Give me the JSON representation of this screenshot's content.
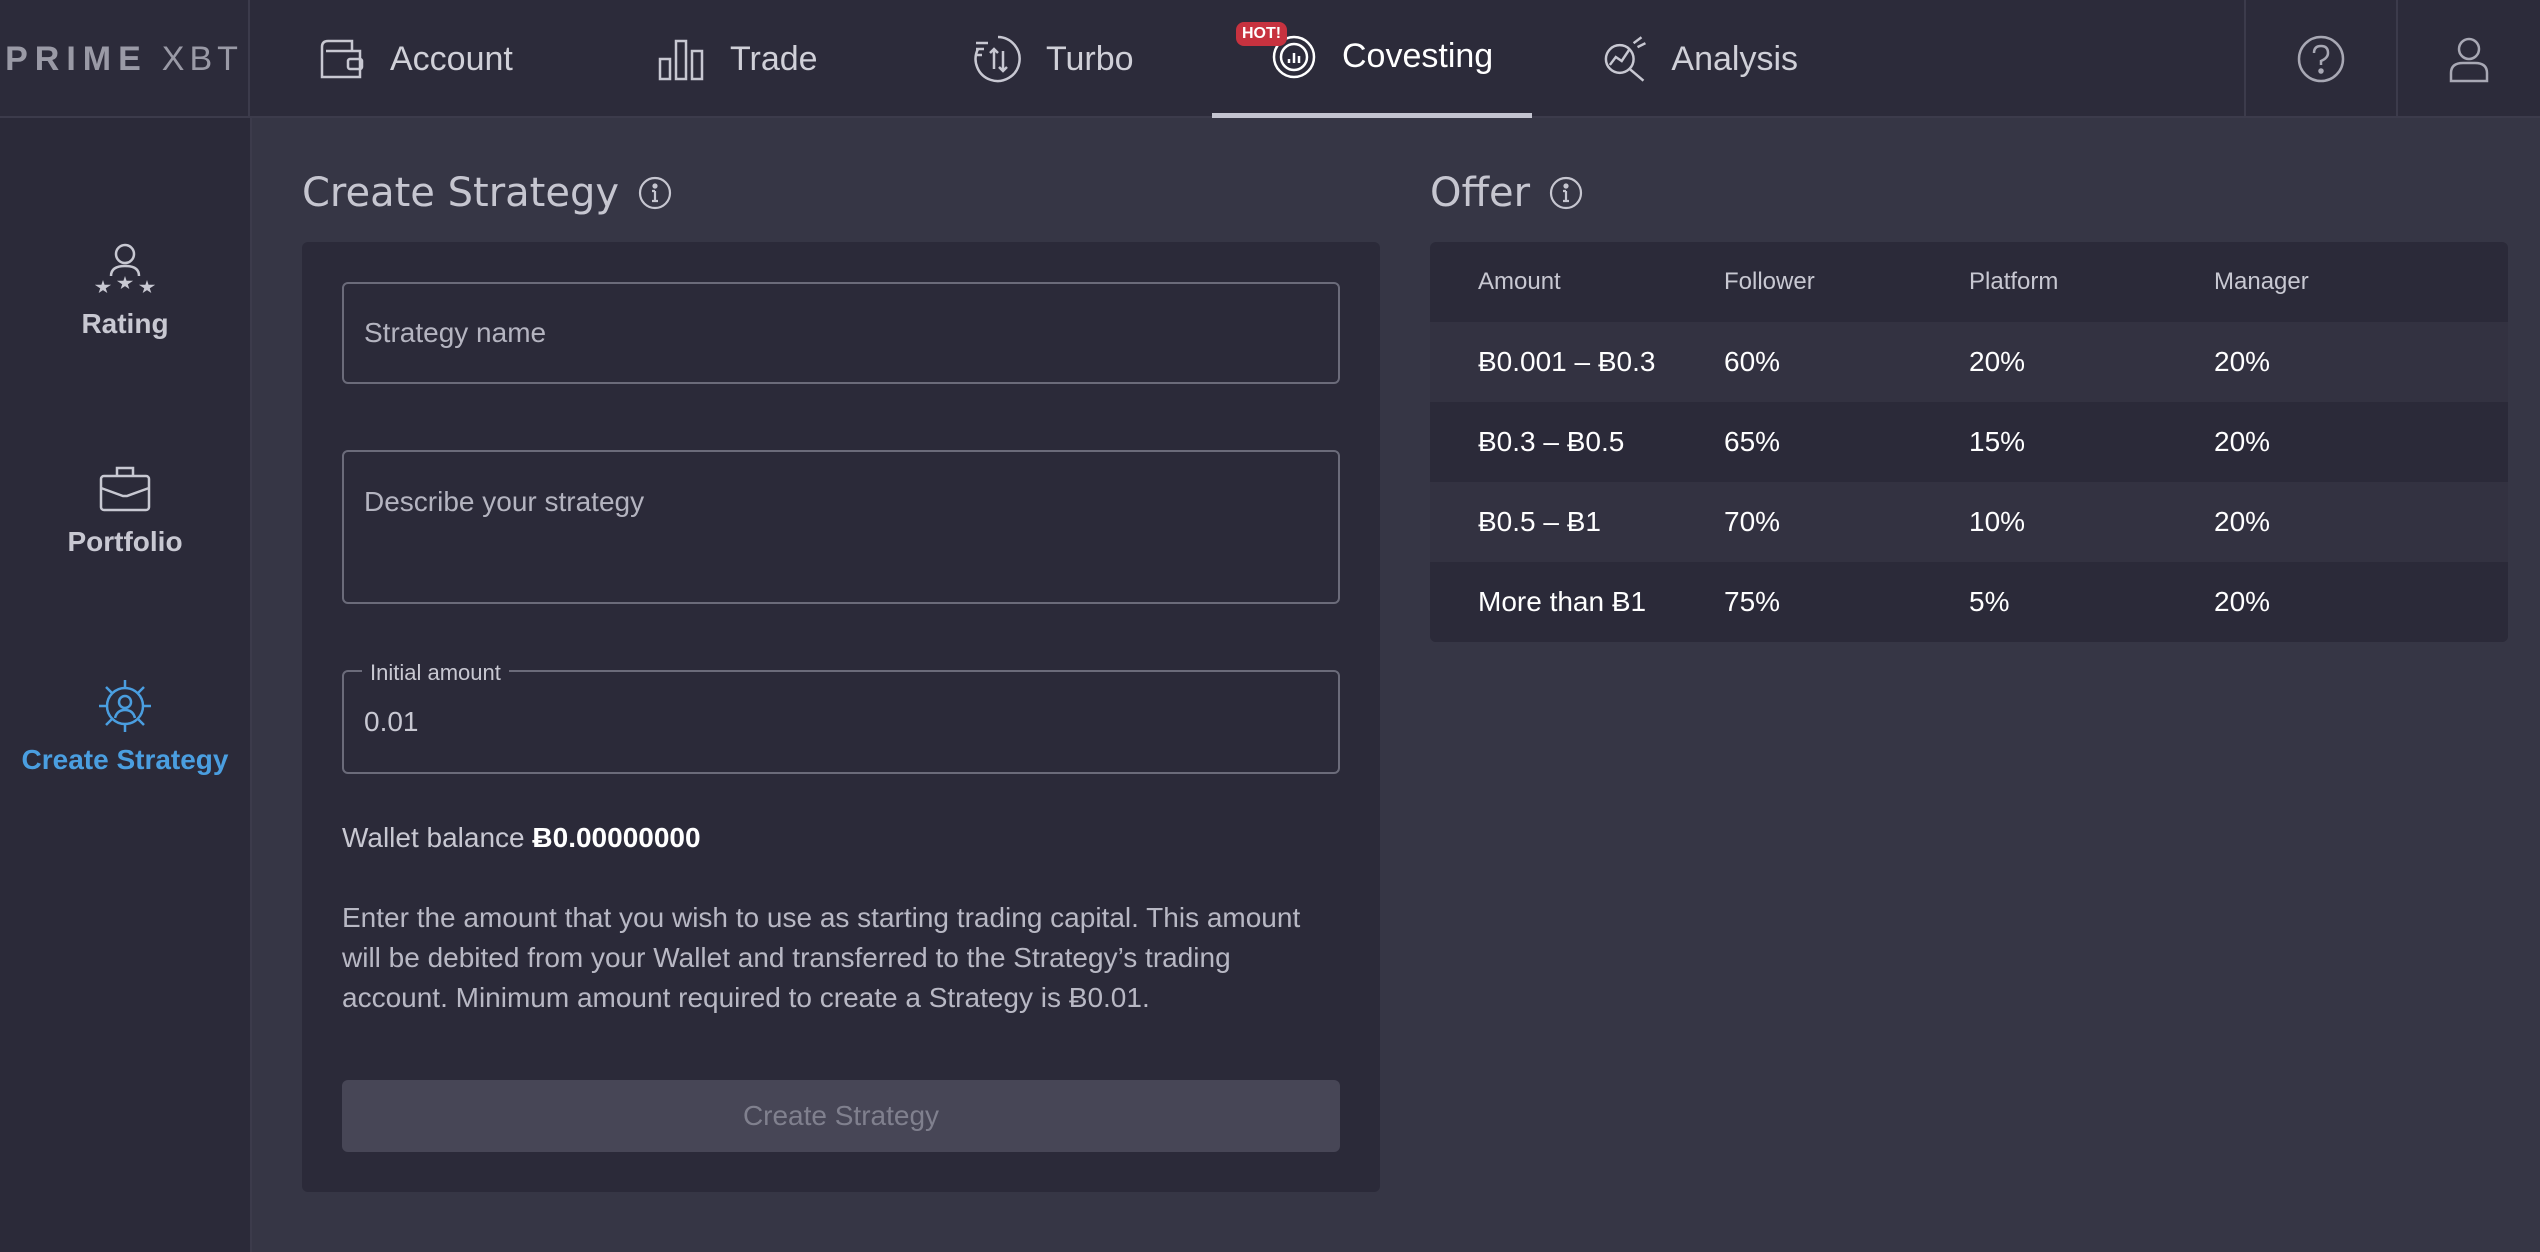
{
  "logo": {
    "brand": "PRIME",
    "suffix": "XBT"
  },
  "nav": {
    "tabs": [
      {
        "label": "Account",
        "icon": "wallet-icon"
      },
      {
        "label": "Trade",
        "icon": "bar-chart-icon"
      },
      {
        "label": "Turbo",
        "icon": "turbo-icon"
      },
      {
        "label": "Covesting",
        "icon": "covesting-icon",
        "badge": "HOT!",
        "active": true
      },
      {
        "label": "Analysis",
        "icon": "analysis-icon"
      }
    ],
    "help_icon": "help-icon",
    "profile_icon": "user-icon"
  },
  "sidebar": {
    "items": [
      {
        "label": "Rating",
        "icon": "rating-icon"
      },
      {
        "label": "Portfolio",
        "icon": "briefcase-icon"
      },
      {
        "label": "Create Strategy",
        "icon": "gear-user-icon",
        "active": true
      }
    ]
  },
  "form": {
    "title": "Create Strategy",
    "name_placeholder": "Strategy name",
    "describe_placeholder": "Describe your strategy",
    "initial_amount_label": "Initial amount",
    "initial_amount_value": "0.01",
    "wallet_label": "Wallet balance",
    "wallet_value": "Ƀ0.00000000",
    "description": "Enter the amount that you wish to use as starting trading capital. This amount will be debited from your Wallet and transferred to the Strategy’s trading account. Minimum amount required to create a Strategy is Ƀ0.01.",
    "submit_label": "Create Strategy"
  },
  "offer": {
    "title": "Offer",
    "columns": [
      "Amount",
      "Follower",
      "Platform",
      "Manager"
    ],
    "rows": [
      [
        "Ƀ0.001 – Ƀ0.3",
        "60%",
        "20%",
        "20%"
      ],
      [
        "Ƀ0.3 – Ƀ0.5",
        "65%",
        "15%",
        "20%"
      ],
      [
        "Ƀ0.5 – Ƀ1",
        "70%",
        "10%",
        "20%"
      ],
      [
        "More than Ƀ1",
        "75%",
        "5%",
        "20%"
      ]
    ]
  },
  "colors": {
    "accent": "#4a9ee0",
    "badge": "#c7323f",
    "background": "#363645",
    "panel": "#2b2a39"
  }
}
